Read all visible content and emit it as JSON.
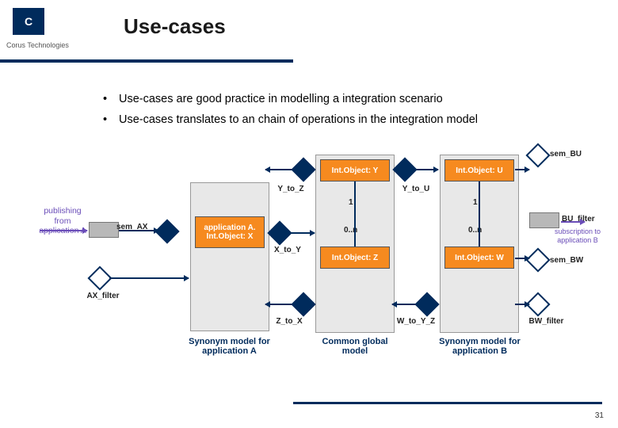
{
  "brand": {
    "logo_letter": "C",
    "caption": "Corus Technologies"
  },
  "title": "Use-cases",
  "bullets": [
    "Use-cases are good practice in modelling a integration scenario",
    "Use-cases translates to an chain of operations in the integration model"
  ],
  "diagram": {
    "left_input": "publishing from application A",
    "right_output": "subscription to application B",
    "columns": {
      "synA": "Synonym model for application A",
      "common": "Common global model",
      "synB": "Synonym model for application B"
    },
    "nodes": {
      "sem_AX": "sem_AX",
      "AX_filter": "AX_filter",
      "appA": "application A. Int.Object: X",
      "intY": "Int.Object: Y",
      "intZ": "Int.Object: Z",
      "intU": "Int.Object: U",
      "intW": "Int.Object: W",
      "sem_BU": "sem_BU",
      "sem_BW": "sem_BW",
      "BU_filter": "BU_filter",
      "BW_filter": "BW_filter"
    },
    "edges": {
      "Y_to_Z": "Y_to_Z",
      "X_to_Y": "X_to_Y",
      "Z_to_X": "Z_to_X",
      "Y_to_U": "Y_to_U",
      "W_to_YZ": "W_to_Y_Z",
      "one_a": "1",
      "card_a": "0..n",
      "one_b": "1",
      "card_b": "0..n"
    }
  },
  "page_number": "31"
}
